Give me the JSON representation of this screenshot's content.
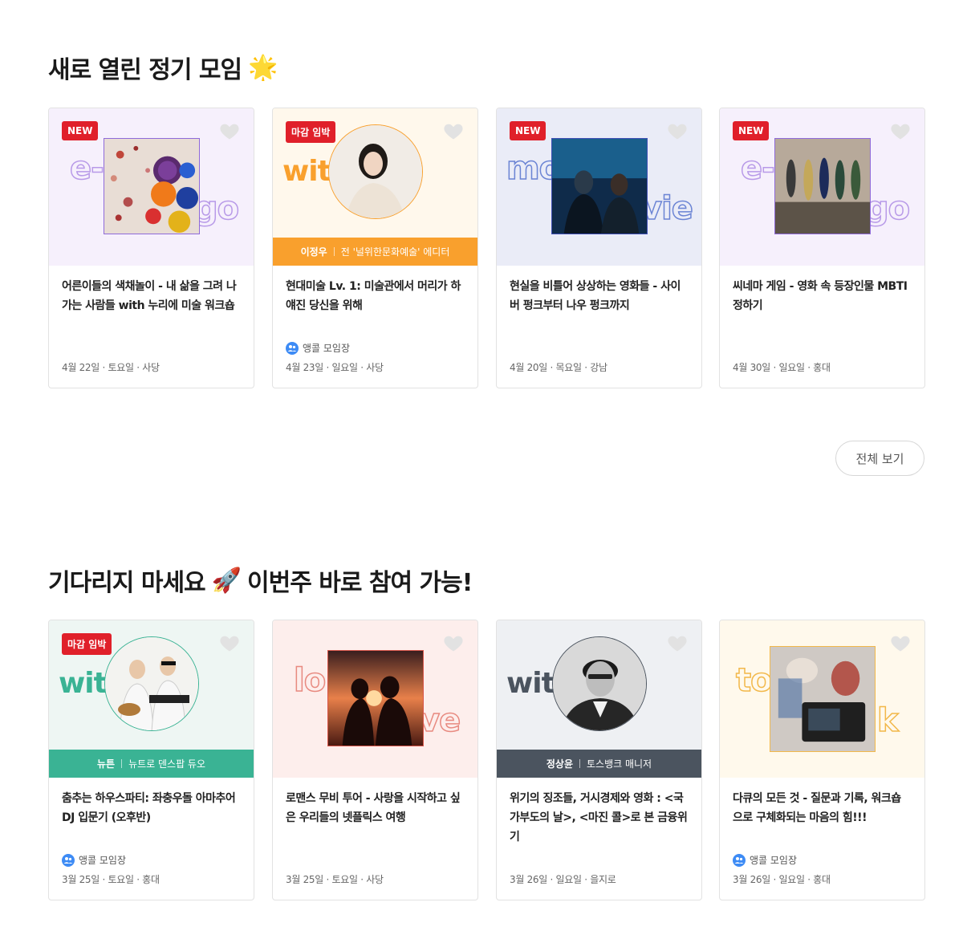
{
  "section1": {
    "title": "새로 열린 정기 모임",
    "emoji": "🌟",
    "view_all_label": "전체 보기",
    "cards": [
      {
        "badge": "NEW",
        "word_left": "e-",
        "word_right": "go",
        "title": "어른이들의 색채놀이 - 내 삶을 그려 나가는 사람들 with 누리에 미술 워크숍",
        "meta": "4월 22일 · 토요일 · 사당"
      },
      {
        "badge": "마감 임박",
        "word_left": "with",
        "host_name": "이정우",
        "host_role": "전 '널위한문화예술' 에디터",
        "title": "현대미술 Lv. 1: 미술관에서 머리가 하얘진 당신을 위해",
        "leader": "앵콜 모임장",
        "meta": "4월 23일 · 일요일 · 사당"
      },
      {
        "badge": "NEW",
        "word_left": "mo",
        "word_right": "vie",
        "title": "현실을 비틀어 상상하는 영화들 - 사이버 펑크부터 나우 펑크까지",
        "meta": "4월 20일 · 목요일 · 강남"
      },
      {
        "badge": "NEW",
        "word_left": "e-",
        "word_right": "go",
        "title": "씨네마 게임 - 영화 속 등장인물 MBTI 정하기",
        "meta": "4월 30일 · 일요일 · 홍대"
      }
    ]
  },
  "section2": {
    "title_left": "기다리지 마세요",
    "emoji": "🚀",
    "title_right": "이번주 바로 참여 가능!",
    "cards": [
      {
        "badge": "마감 임박",
        "word_left": "with",
        "host_name": "뉴튼",
        "host_role": "뉴트로 덴스팝 듀오",
        "title": "춤추는 하우스파티: 좌충우돌 아마추어 DJ 입문기 (오후반)",
        "leader": "앵콜 모임장",
        "meta": "3월 25일 · 토요일 · 홍대"
      },
      {
        "word_left": "lo",
        "word_right": "ve",
        "title": "로맨스 무비 투어 - 사랑을 시작하고 싶은 우리들의 넷플릭스 여행",
        "meta": "3월 25일 · 토요일 · 사당"
      },
      {
        "word_left": "with",
        "host_name": "정상윤",
        "host_role": "토스뱅크 매니저",
        "title": "위기의 징조들, 거시경제와 영화 : <국가부도의 날>, <마진 콜>로 본 금융위기",
        "meta": "3월 26일 · 일요일 · 을지로"
      },
      {
        "word_left": "to",
        "word_right": "k",
        "title": "다큐의 모든 것 - 질문과 기록, 워크숍으로 구체화되는 마음의 힘!!!",
        "leader": "앵콜 모임장",
        "meta": "3월 26일 · 일요일 · 홍대"
      }
    ]
  },
  "colors": {
    "badge_red": "#e0202a",
    "orange_bar": "#f9a02d",
    "teal_bar": "#3ab394",
    "slate_bar": "#4b545f",
    "leader_blue": "#3d8bf5"
  }
}
